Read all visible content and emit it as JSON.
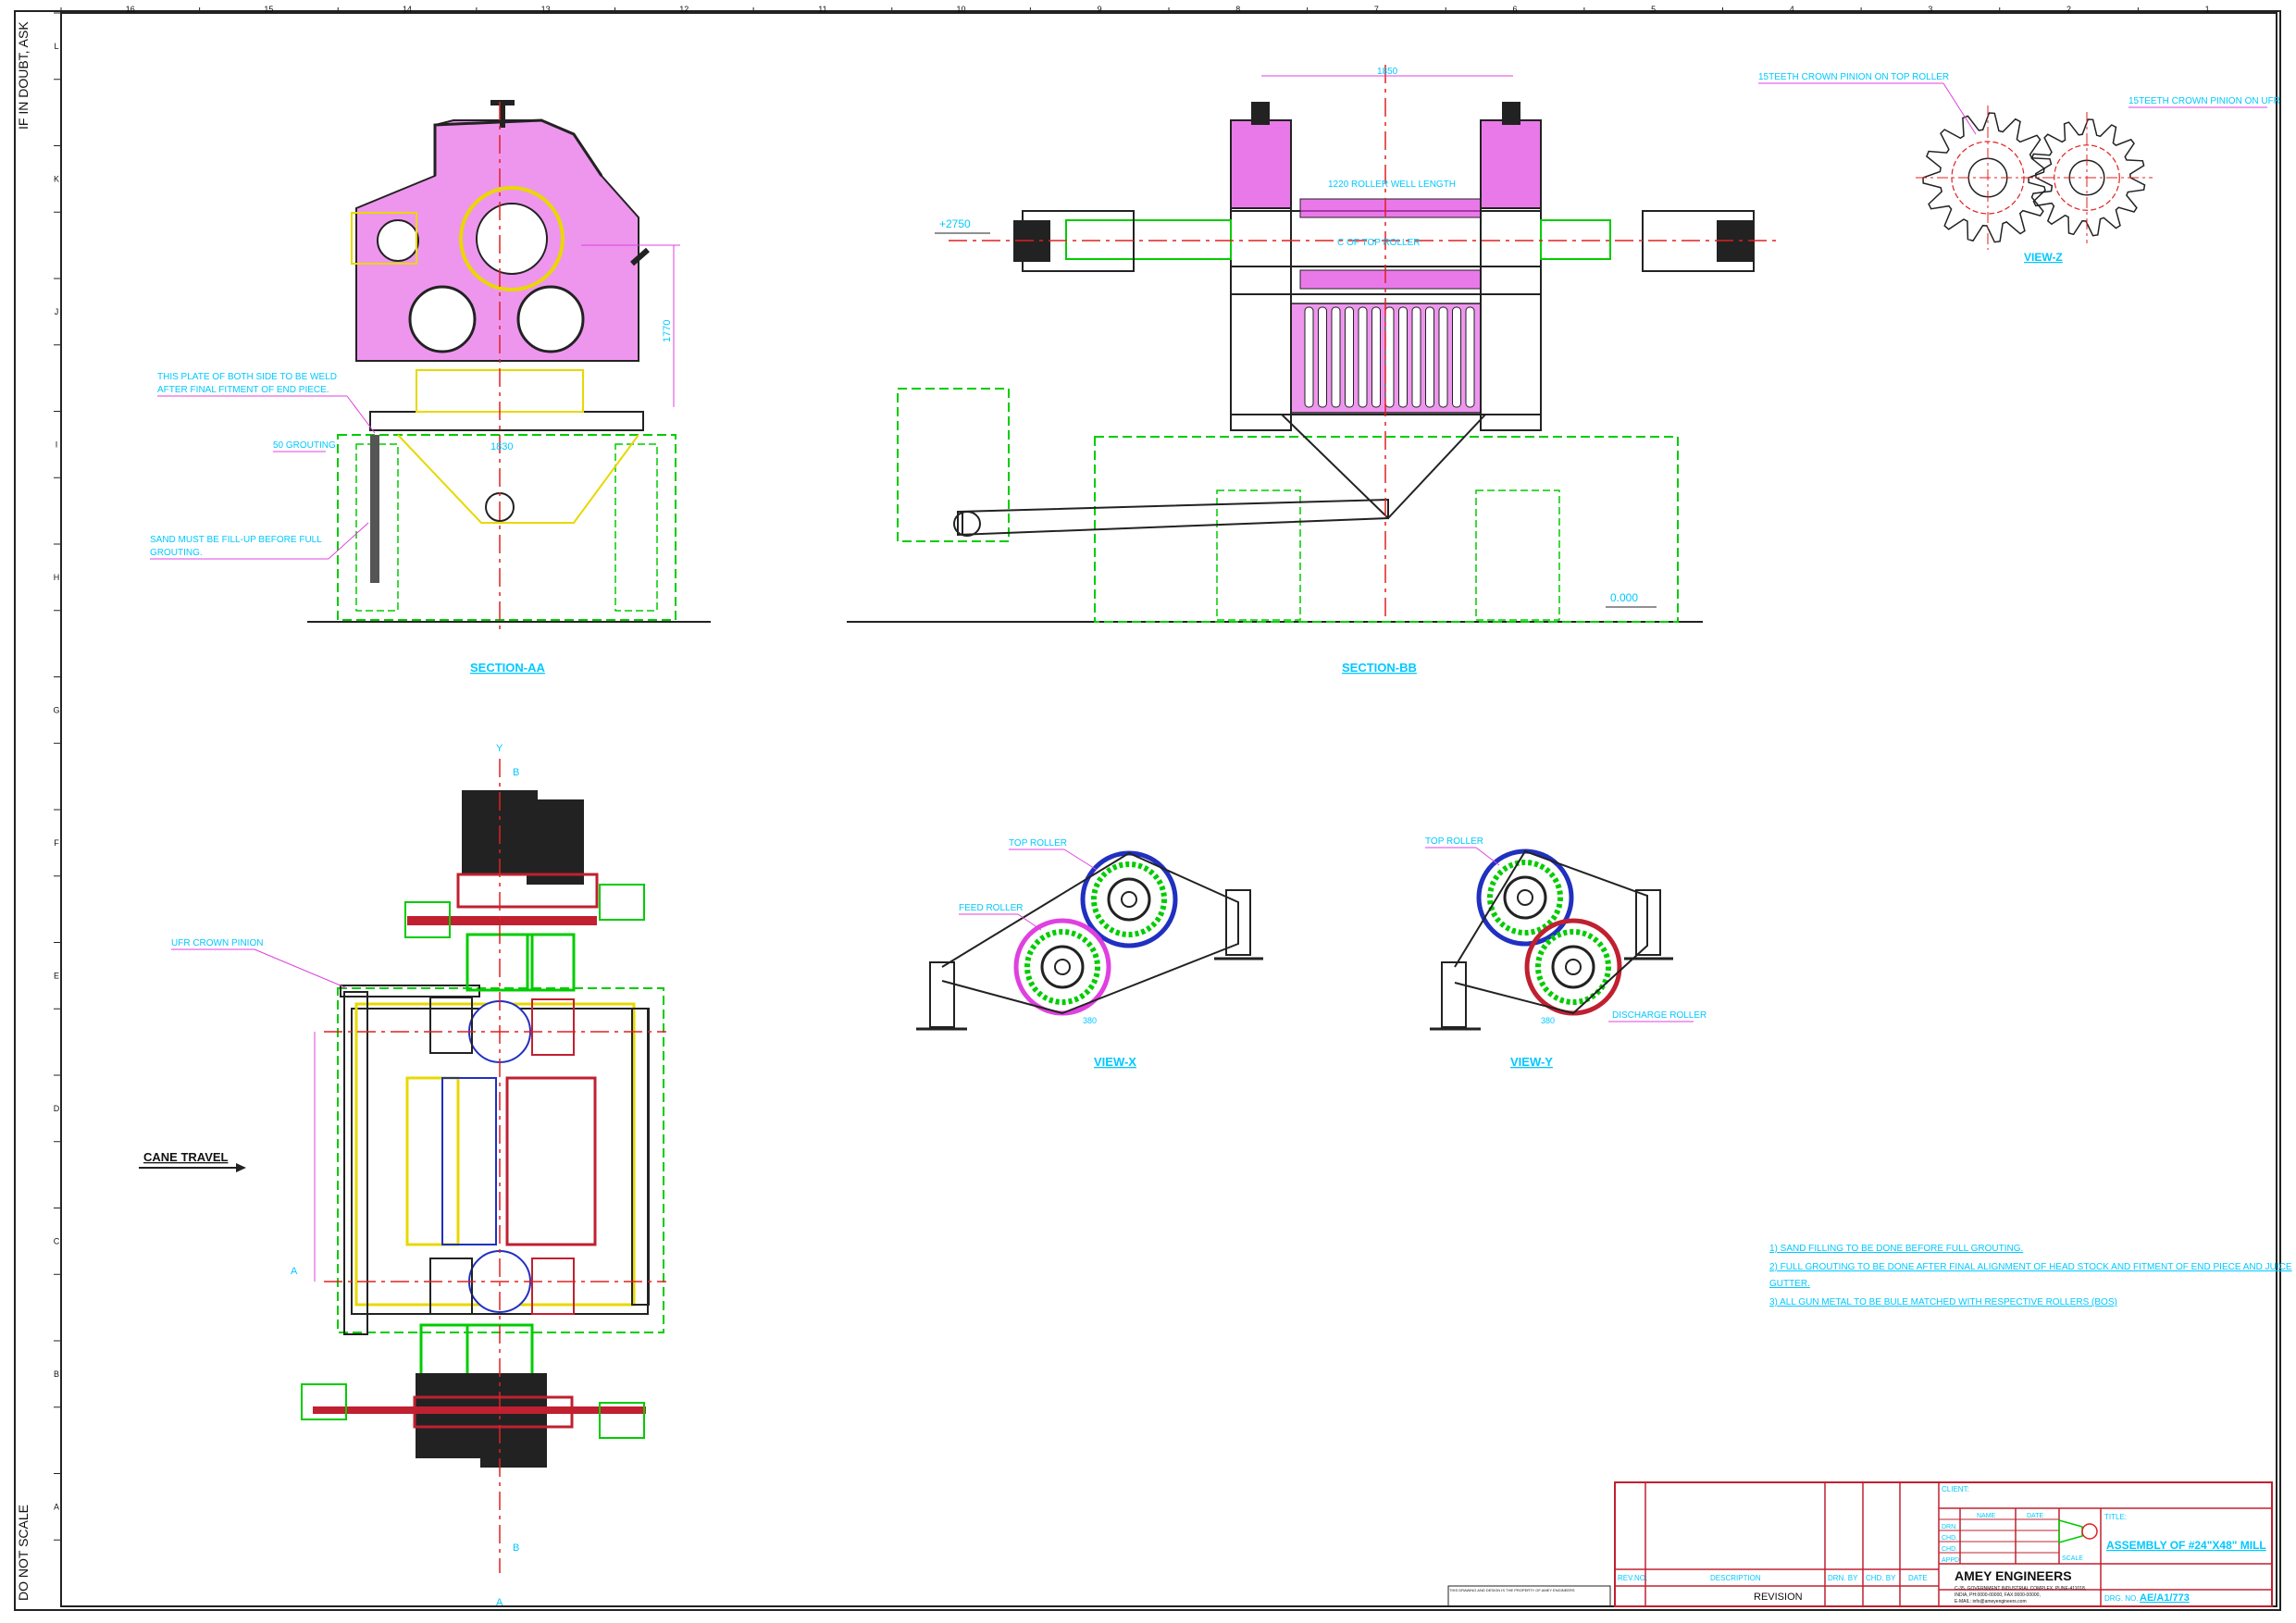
{
  "sheet": {
    "columns": [
      "16",
      "15",
      "14",
      "13",
      "12",
      "11",
      "10",
      "9",
      "8",
      "7",
      "6",
      "5",
      "4",
      "3",
      "2",
      "1"
    ],
    "rows": [
      "L",
      "K",
      "J",
      "I",
      "H",
      "G",
      "F",
      "E",
      "D",
      "C",
      "B",
      "A"
    ],
    "side_top": "IF IN DOUBT, ASK",
    "side_bottom": "DO NOT SCALE"
  },
  "section_aa": {
    "title": "SECTION-AA",
    "note_plate": [
      "THIS PLATE OF BOTH SIDE TO BE WELD",
      "AFTER FINAL FITMENT OF END PIECE."
    ],
    "note_grouting": "50 GROUTING",
    "note_sand": [
      "SAND MUST BE FILL-UP BEFORE FULL",
      "GROUTING."
    ],
    "dim_width": "1830",
    "dim_height": "1770"
  },
  "section_bb": {
    "title": "SECTION-BB",
    "dim_top": "1850",
    "roller_length": "1220 ROLLER WELL LENGTH",
    "top_roller_cl": "C OF TOP ROLLER",
    "level_top": "+2750",
    "level_zero": "0.000"
  },
  "view_z": {
    "title": "VIEW-Z",
    "note_top": "15TEETH CROWN PINION ON TOP ROLLER",
    "note_ufr": "15TEETH CROWN PINION ON UFR"
  },
  "view_x": {
    "title": "VIEW-X",
    "top_roller": "TOP ROLLER",
    "feed_roller": "FEED ROLLER",
    "dim": "380"
  },
  "view_y": {
    "title": "VIEW-Y",
    "top_roller": "TOP ROLLER",
    "discharge_roller": "DISCHARGE ROLLER",
    "dim": "380"
  },
  "plan": {
    "ufr_note": "UFR CROWN PINION",
    "cane_travel": "CANE TRAVEL",
    "marker_y": "Y",
    "marker_b": "B",
    "marker_a": "A"
  },
  "notes": [
    "1) SAND FILLING TO BE DONE BEFORE FULL GROUTING.",
    "2) FULL GROUTING TO BE DONE AFTER FINAL ALIGNMENT OF HEAD STOCK AND FITMENT OF END PIECE AND JUICE",
    "GUTTER.",
    "3) ALL GUN METAL TO BE BULE MATCHED WITH RESPECTIVE ROLLERS (BOS)"
  ],
  "title_block": {
    "revision_headers": [
      "REV.NO.",
      "DESCRIPTION",
      "DRN. BY",
      "CHD. BY",
      "DATE"
    ],
    "revision_label": "REVISION",
    "client_label": "CLIENT:",
    "name_header": "NAME",
    "date_header": "DATE",
    "roles": [
      "DRN.",
      "CHD.",
      "CHD.",
      "APPD."
    ],
    "company": "AMEY ENGINEERS",
    "company_address": [
      "C-35, GOVERNMENT INDUSTRIAL COMPLEX, PUNE-411018,",
      "INDIA, PH:0000-00000, FAX:0000-00000,",
      "E-MAIL: info@ameyengineers.com"
    ],
    "title_label": "TITLE:",
    "drawing_title": "ASSEMBLY OF #24\"X48\" MILL",
    "scale_label": "SCALE",
    "dwg_label": "DRG. NO.",
    "dwg_no": "AE/A1/773"
  },
  "colors": {
    "border": "#222222",
    "cyan": "#00c8ff",
    "magenta": "#e040e0",
    "green": "#00cc00",
    "red": "#e02020",
    "yellow": "#e8d800",
    "blue": "#2030c0"
  }
}
